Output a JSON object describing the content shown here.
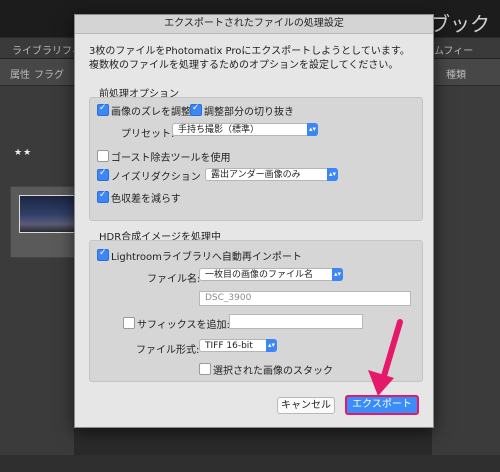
{
  "background": {
    "title": "ブック",
    "toolbar_left": "ライブラリフィ",
    "toolbar_right": "ムフィー",
    "toolbar2_left": "属性",
    "toolbar2_mid": "フラグ",
    "toolbar2_right": "種類",
    "thumbnail_rating": "★★"
  },
  "dialog": {
    "title": "エクスポートされたファイルの処理設定",
    "intro_line1": "3枚のファイルをPhotomatix Proにエクスポートしようとしています。",
    "intro_line2": "複数枚のファイルを処理するためのオプションを設定してください。",
    "preprocess": {
      "title": "前処理オプション",
      "align_label": "画像のズレを調整",
      "align_checked": true,
      "crop_label": "調整部分の切り抜き",
      "crop_checked": true,
      "preset_label": "プリセット:",
      "preset_value": "手持ち撮影（標準）",
      "ghost_label": "ゴースト除去ツールを使用",
      "ghost_checked": false,
      "noise_label": "ノイズリダクション",
      "noise_checked": true,
      "noise_value": "露出アンダー画像のみ",
      "chroma_label": "色収差を減らす",
      "chroma_checked": true
    },
    "hdr": {
      "title": "HDR合成イメージを処理中",
      "reimport_label": "Lightroomライブラリへ自動再インポート",
      "reimport_checked": true,
      "filename_label": "ファイル名:",
      "filename_value": "一枚目の画像のファイル名",
      "filename_text": "DSC_3900",
      "suffix_label": "サフィックスを追加:",
      "suffix_checked": false,
      "suffix_value": "",
      "format_label": "ファイル形式:",
      "format_value": "TIFF 16-bit",
      "stack_label": "選択された画像のスタック",
      "stack_checked": false
    },
    "cancel_label": "キャンセル",
    "export_label": "エクスポート"
  },
  "colors": {
    "accent": "#3a8cf8",
    "highlight": "#e5196a"
  }
}
